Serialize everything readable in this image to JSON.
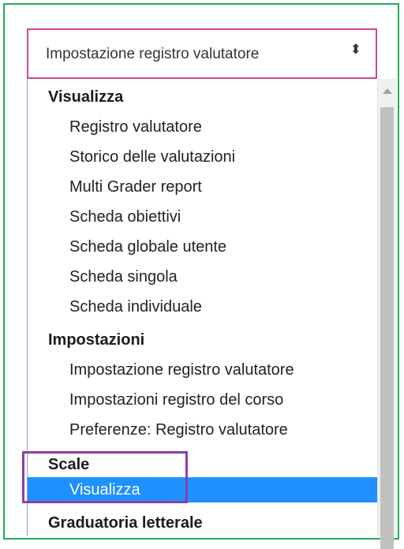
{
  "select": {
    "value": "Impostazione registro valutatore",
    "arrow_icon": "up-down-arrows-icon"
  },
  "list": {
    "groups": [
      {
        "label": "Visualizza",
        "options": [
          "Registro valutatore",
          "Storico delle valutazioni",
          "Multi Grader report",
          "Scheda obiettivi",
          "Scheda globale utente",
          "Scheda singola",
          "Scheda individuale"
        ]
      },
      {
        "label": "Impostazioni",
        "options": [
          "Impostazione registro valutatore",
          "Impostazioni registro del corso",
          "Preferenze: Registro valutatore"
        ]
      },
      {
        "label": "Scale",
        "options": [
          "Visualizza"
        ]
      },
      {
        "label": "Graduatoria letterale",
        "options": []
      }
    ],
    "selected_option": "Visualizza"
  },
  "colors": {
    "frame_border": "#1fae5c",
    "select_border": "#c9488f",
    "selected_bg": "#1e90ff",
    "highlight_box": "#8b3fa6"
  }
}
